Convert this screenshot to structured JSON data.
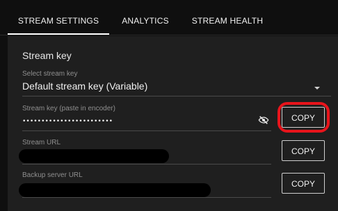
{
  "tabs": [
    {
      "label": "STREAM SETTINGS",
      "active": true
    },
    {
      "label": "ANALYTICS",
      "active": false
    },
    {
      "label": "STREAM HEALTH",
      "active": false
    }
  ],
  "stream_key_section": {
    "title": "Stream key",
    "select_label": "Select stream key",
    "select_value": "Default stream key (Variable)",
    "key_label": "Stream key (paste in encoder)",
    "key_value_masked": "••••••••••••••••••••••••",
    "url_label": "Stream URL",
    "backup_label": "Backup server URL",
    "copy_label": "COPY"
  },
  "icons": {
    "visibility_toggle": "eye-slash-icon",
    "dropdown": "chevron-down-icon"
  },
  "colors": {
    "background": "#0f0f0f",
    "panel": "#1f1f1f",
    "highlight": "#e8141b"
  }
}
